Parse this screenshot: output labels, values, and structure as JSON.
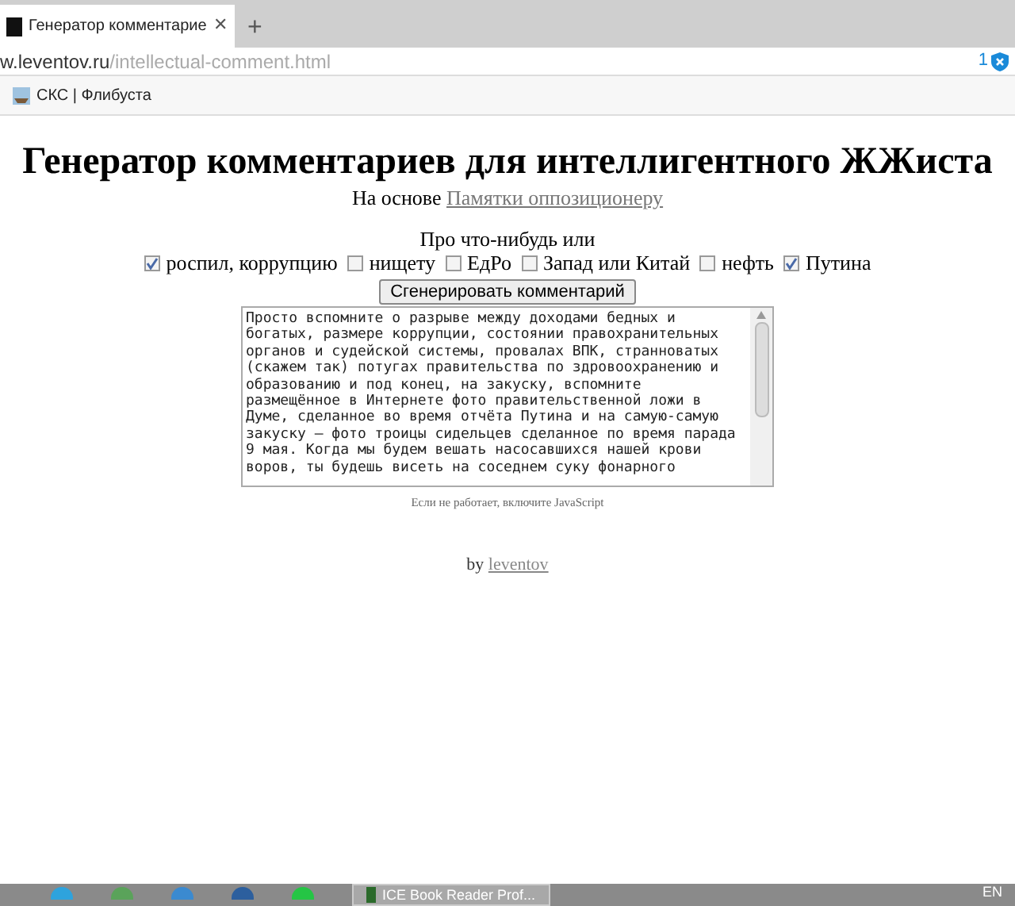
{
  "browser": {
    "tab": {
      "title": "Генератор комментарие",
      "close": "✕",
      "selected": true
    },
    "new_tab": "+",
    "address": {
      "host": "w.leventov.ru",
      "path": "/intellectual-comment.html",
      "badge": "1"
    },
    "bookmarks": [
      "СКС | Флибуста"
    ]
  },
  "page": {
    "title": "Генератор комментариев для интеллигентного ЖЖиста",
    "subtitle": "На основе",
    "subtitle_link": "Памятки оппозиционеру",
    "prompt": "Про что-нибудь или",
    "topics": [
      {
        "label": "роспил, коррупцию",
        "checked": true
      },
      {
        "label": "нищету",
        "checked": false
      },
      {
        "label": "ЕдРо",
        "checked": false
      },
      {
        "label": "Запад или Китай",
        "checked": false
      },
      {
        "label": "нефть",
        "checked": false
      },
      {
        "label": "Путина",
        "checked": true
      }
    ],
    "generate_button": "Сгенерировать комментарий",
    "comment": "Просто вспомните о разрыве между доходами бедных и\nбогатых, размере коррупции, состоянии правохранительных\nорганов и судейской системы, провалах ВПК, странноватых\n(скажем так) потугах правительства по здровоохранению и\nобразованию и под конец, на закуску, вспомните\nразмещённое в Интернете фото правительственной ложи в\nДуме, сделанное во время отчёта Путина и на самую-самую\nзакуску — фото троицы сидельцев сделанное по время парада\n9 мая. Когда мы будем вешать насосавшихся нашей крови\nворов, ты будешь висеть на соседнем суку фонарного",
    "note": "Если не работает, включите JavaScript",
    "byline": "by",
    "byline_link": "leventov"
  },
  "taskbar": {
    "window": "ICE Book Reader Prof...",
    "language": "EN"
  }
}
